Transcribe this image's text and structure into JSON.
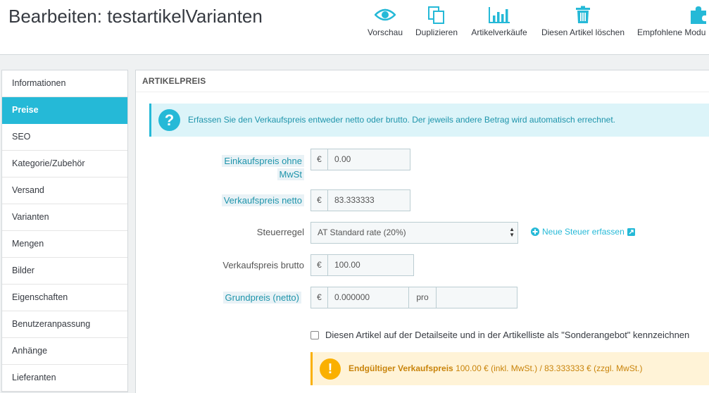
{
  "header": {
    "title": "Bearbeiten: testartikelVarianten",
    "toolbar": [
      {
        "label": "Vorschau",
        "icon": "eye-icon"
      },
      {
        "label": "Duplizieren",
        "icon": "copy-icon"
      },
      {
        "label": "Artikelverkäufe",
        "icon": "bar-chart-icon"
      },
      {
        "label": "Diesen Artikel löschen",
        "icon": "trash-icon"
      },
      {
        "label": "Empfohlene Modu",
        "icon": "puzzle-icon"
      }
    ]
  },
  "sidebar": {
    "items": [
      {
        "label": "Informationen"
      },
      {
        "label": "Preise",
        "active": true
      },
      {
        "label": "SEO"
      },
      {
        "label": "Kategorie/Zubehör"
      },
      {
        "label": "Versand"
      },
      {
        "label": "Varianten"
      },
      {
        "label": "Mengen"
      },
      {
        "label": "Bilder"
      },
      {
        "label": "Eigenschaften"
      },
      {
        "label": "Benutzeranpassung"
      },
      {
        "label": "Anhänge"
      },
      {
        "label": "Lieferanten"
      }
    ]
  },
  "panel": {
    "heading": "ARTIKELPREIS",
    "info_alert": "Erfassen Sie den Verkaufspreis entweder netto oder brutto. Der jeweils andere Betrag wird automatisch errechnet.",
    "fields": {
      "purchase_price": {
        "label": "Einkaufspreis ohne MwSt",
        "currency": "€",
        "value": "0.00"
      },
      "net_price": {
        "label": "Verkaufspreis netto",
        "currency": "€",
        "value": "83.333333"
      },
      "tax_rule": {
        "label": "Steuerregel",
        "value": "AT Standard rate (20%)"
      },
      "gross_price": {
        "label": "Verkaufspreis brutto",
        "currency": "€",
        "value": "100.00"
      },
      "unit_price": {
        "label": "Grundpreis (netto)",
        "currency": "€",
        "value": "0.000000",
        "per_label": "pro",
        "unit": ""
      }
    },
    "new_tax_link": "Neue Steuer erfassen",
    "on_sale_checkbox": {
      "label": "Diesen Artikel auf der Detailseite und in der Artikelliste als \"Sonderangebot\" kennzeichnen",
      "checked": false
    },
    "final_price": {
      "label": "Endgültiger Verkaufspreis",
      "text": "100.00 € (inkl. MwSt.) / 83.333333 € (zzgl. MwSt.)"
    }
  },
  "colors": {
    "accent": "#25b9d7",
    "warning": "#fab000"
  }
}
